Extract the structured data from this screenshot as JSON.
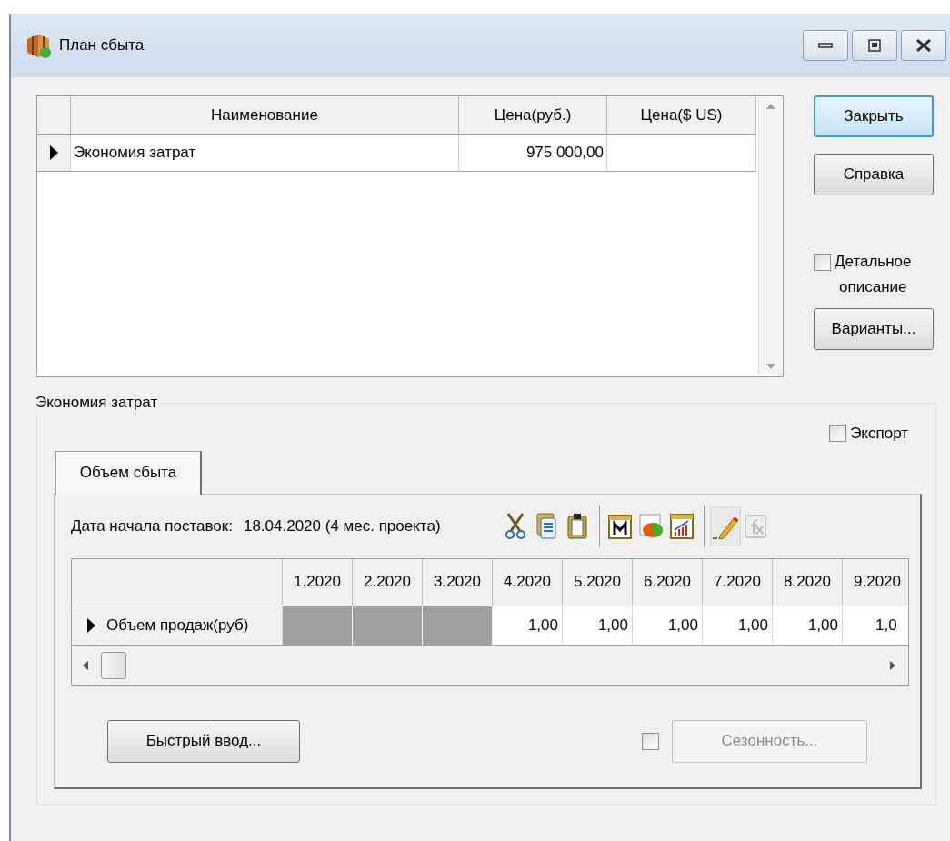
{
  "window": {
    "title": "План сбыта"
  },
  "products_table": {
    "columns": [
      "Наименование",
      "Цена(руб.)",
      "Цена($ US)"
    ],
    "rows": [
      {
        "name": "Экономия затрат",
        "price_rub": "975 000,00",
        "selected": true
      }
    ]
  },
  "side_buttons": [
    {
      "label": "Закрыть",
      "default": true
    },
    {
      "label": "Справка",
      "default": false
    }
  ],
  "detailed_description": {
    "label_lines": [
      "Детальное",
      "описание"
    ],
    "checked": false
  },
  "variants_button": "Варианты...",
  "group": {
    "title": "Экономия затрат",
    "export": {
      "label": "Экспорт",
      "checked": false
    },
    "tabs": [
      {
        "label": "Объем сбыта",
        "selected": true
      }
    ],
    "start_date": {
      "label": "Дата начала поставок:",
      "value": "18.04.2020 (4 мес. проекта)"
    },
    "toolbar": [
      {
        "kind": "scissors",
        "pressed": false,
        "disabled": false
      },
      {
        "kind": "copy",
        "pressed": false,
        "disabled": false
      },
      {
        "kind": "clipboard",
        "pressed": false,
        "disabled": false
      },
      {
        "kind": "separator"
      },
      {
        "kind": "calendar",
        "pressed": false,
        "disabled": false
      },
      {
        "kind": "pie",
        "pressed": false,
        "disabled": false
      },
      {
        "kind": "growth",
        "pressed": false,
        "disabled": false
      },
      {
        "kind": "separator"
      },
      {
        "kind": "pencil",
        "pressed": true,
        "disabled": false
      },
      {
        "kind": "formula",
        "pressed": false,
        "disabled": true
      }
    ],
    "sales_grid": {
      "columns": [
        "1.2020",
        "2.2020",
        "3.2020",
        "4.2020",
        "5.2020",
        "6.2020",
        "7.2020",
        "8.2020",
        "9.2020"
      ],
      "rows": [
        {
          "label": "Объем продаж(руб)",
          "selected": true,
          "cells": [
            {
              "inactive": true
            },
            {
              "inactive": true
            },
            {
              "inactive": true
            },
            {
              "value": "1,00",
              "inactive": false
            },
            {
              "value": "1,00",
              "inactive": false
            },
            {
              "value": "1,00",
              "inactive": false
            },
            {
              "value": "1,00",
              "inactive": false
            },
            {
              "value": "1,00",
              "inactive": false
            },
            {
              "value": "1,0",
              "inactive": false
            }
          ]
        }
      ]
    },
    "quick_input_button": "Быстрый ввод...",
    "seasonality": {
      "checked": false,
      "button": "Сезонность...",
      "disabled": true
    }
  }
}
